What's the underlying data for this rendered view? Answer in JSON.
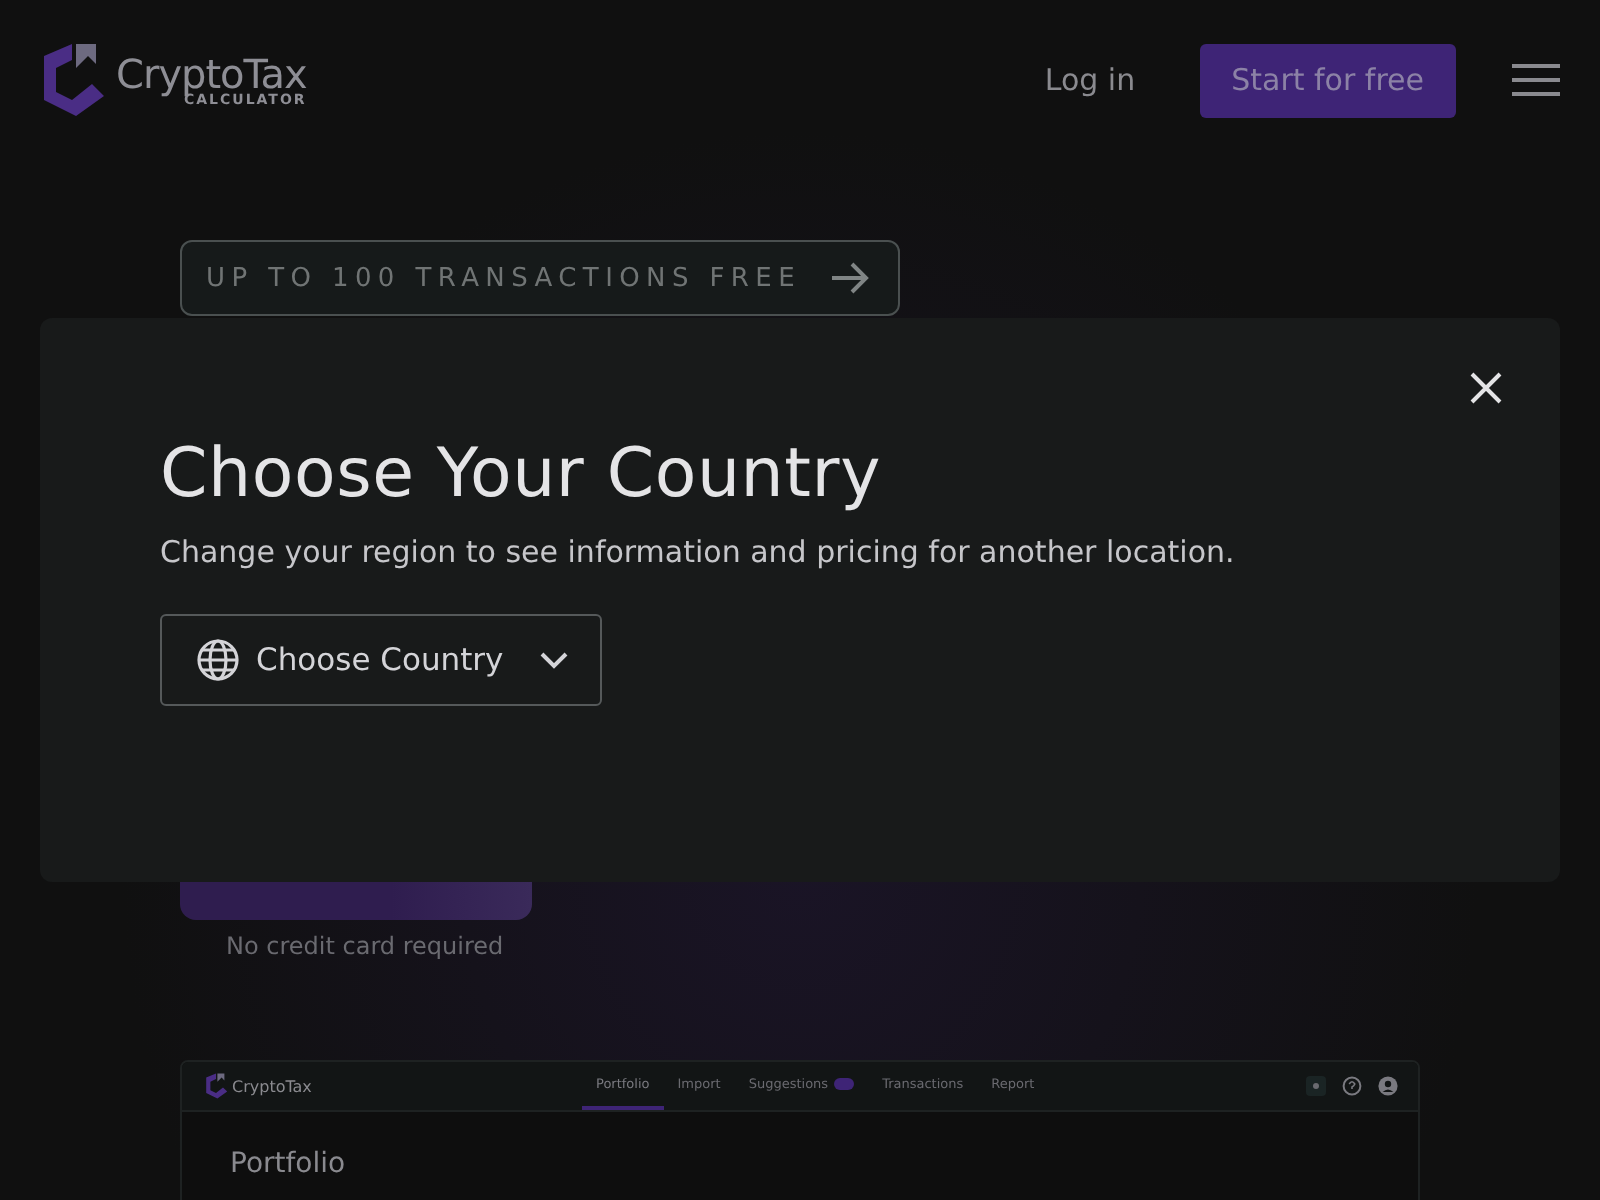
{
  "header": {
    "logo": {
      "name": "CryptoTax",
      "tagline": "CALCULATOR"
    },
    "login": "Log in",
    "cta": "Start for free"
  },
  "hero": {
    "badge": "UP TO 100 TRANSACTIONS FREE",
    "note": "No credit card required"
  },
  "preview": {
    "logo": "CryptoTax",
    "tabs": [
      {
        "label": "Portfolio",
        "selected": true
      },
      {
        "label": "Import",
        "selected": false
      },
      {
        "label": "Suggestions",
        "selected": false,
        "badge": true
      },
      {
        "label": "Transactions",
        "selected": false
      },
      {
        "label": "Report",
        "selected": false
      }
    ],
    "heading": "Portfolio"
  },
  "modal": {
    "title": "Choose Your Country",
    "description": "Change your region to see information and pricing for another location.",
    "select": {
      "placeholder": "Choose Country"
    }
  }
}
